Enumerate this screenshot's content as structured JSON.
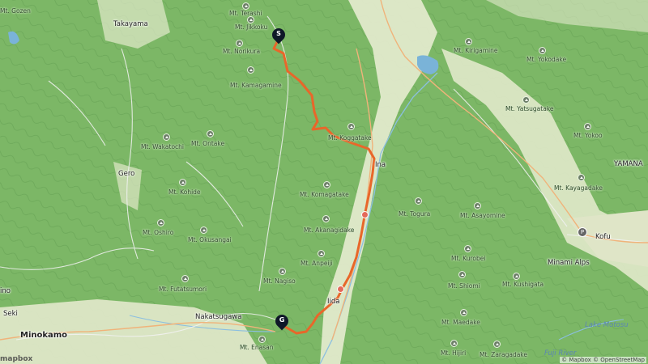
{
  "map": {
    "start_marker": "S",
    "goal_marker": "G",
    "route_color": "#e8672a",
    "peaks": [
      "Mt. Terashi",
      "Mt. Jikkoku",
      "Mt. Norikura",
      "Mt. Kamagamine",
      "Mt. Kirigamine",
      "Mt. Yokodake",
      "Mt. Yatsugatake",
      "Mt. Koggatake",
      "Mt. Wakatochi",
      "Mt. Ontake",
      "Mt. Kohide",
      "Mt. Yokoo",
      "Mt. Kayagadake",
      "Mt. Komagatake",
      "Mt. Togura",
      "Mt. Asayomine",
      "Mt. Oshiro",
      "Mt. Okusangai",
      "Mt. Akanagidake",
      "Mt. Anpeiji",
      "Mt. Kurobei",
      "Mt. Kushigata",
      "Mt. Shiomi",
      "Mt. Nagiso",
      "Mt. Futatsumori",
      "Mt. Maedake",
      "Mt. Enasan",
      "Mt. Hijiri",
      "Mt. Zaragadake",
      "Mt. Gozen"
    ],
    "places": [
      "Takayama",
      "Gero",
      "Ina",
      "Iida",
      "Kofu",
      "Minami Alps",
      "Nakatsugawa",
      "Minokamo",
      "Seki",
      "ino",
      "YAMANA",
      "Fuji River",
      "Lake Motosu"
    ],
    "attribution": "© Mapbox © OpenStreetMap",
    "logo": "mapbox"
  }
}
